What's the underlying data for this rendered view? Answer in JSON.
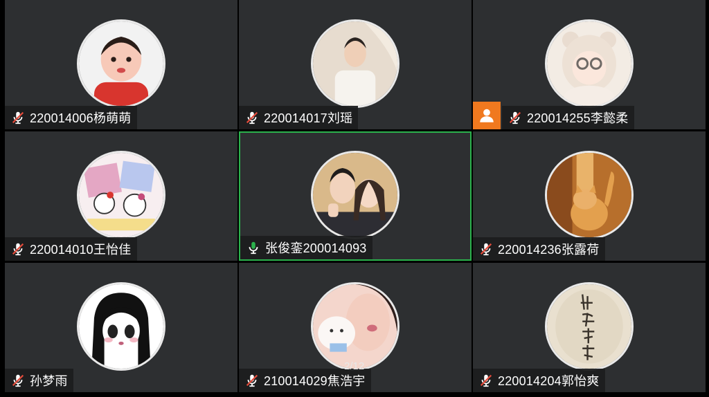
{
  "participants": [
    {
      "name": "220014006杨萌萌",
      "mic": "muted",
      "avatar_colors": [
        "#f2f2f2",
        "#f7c9b8",
        "#d8352e"
      ]
    },
    {
      "name": "220014017刘瑶",
      "mic": "muted",
      "avatar_colors": [
        "#e7dccf",
        "#f6f3ee",
        "#2a2320"
      ]
    },
    {
      "name": "220014255李懿柔",
      "mic": "muted",
      "host": true,
      "avatar_colors": [
        "#f3ece4",
        "#fbe7dc",
        "#6f6a66"
      ]
    },
    {
      "name": "220014010王怡佳",
      "mic": "muted",
      "avatar_colors": [
        "#f7eef0",
        "#e4a7c4",
        "#c54b7a"
      ]
    },
    {
      "name": "张俊銮200014093",
      "mic": "active",
      "active_speaker": true,
      "avatar_colors": [
        "#d9b98a",
        "#f2d3bd",
        "#1f1c1c"
      ]
    },
    {
      "name": "220014236张露荷",
      "mic": "muted",
      "avatar_colors": [
        "#b76f2c",
        "#e3a04e",
        "#5a351a"
      ]
    },
    {
      "name": "孙梦雨",
      "mic": "muted",
      "avatar_colors": [
        "#ffffff",
        "#111111",
        "#f3b8c3"
      ]
    },
    {
      "name": "210014029焦浩宇",
      "mic": "muted",
      "avatar_colors": [
        "#f4d6cc",
        "#fbf7f5",
        "#cf6c7a"
      ]
    },
    {
      "name": "220014204郭怡爽",
      "mic": "muted",
      "avatar_colors": [
        "#e9e0cf",
        "#cbbfa7",
        "#3b342c"
      ]
    }
  ],
  "page_indicator": "2/12",
  "colors": {
    "tile_bg": "#2d2f31",
    "active_border": "#2bb24c",
    "host_badge": "#f0791f",
    "mic_muted": "#e24b3b",
    "mic_active": "#2bb24c"
  }
}
